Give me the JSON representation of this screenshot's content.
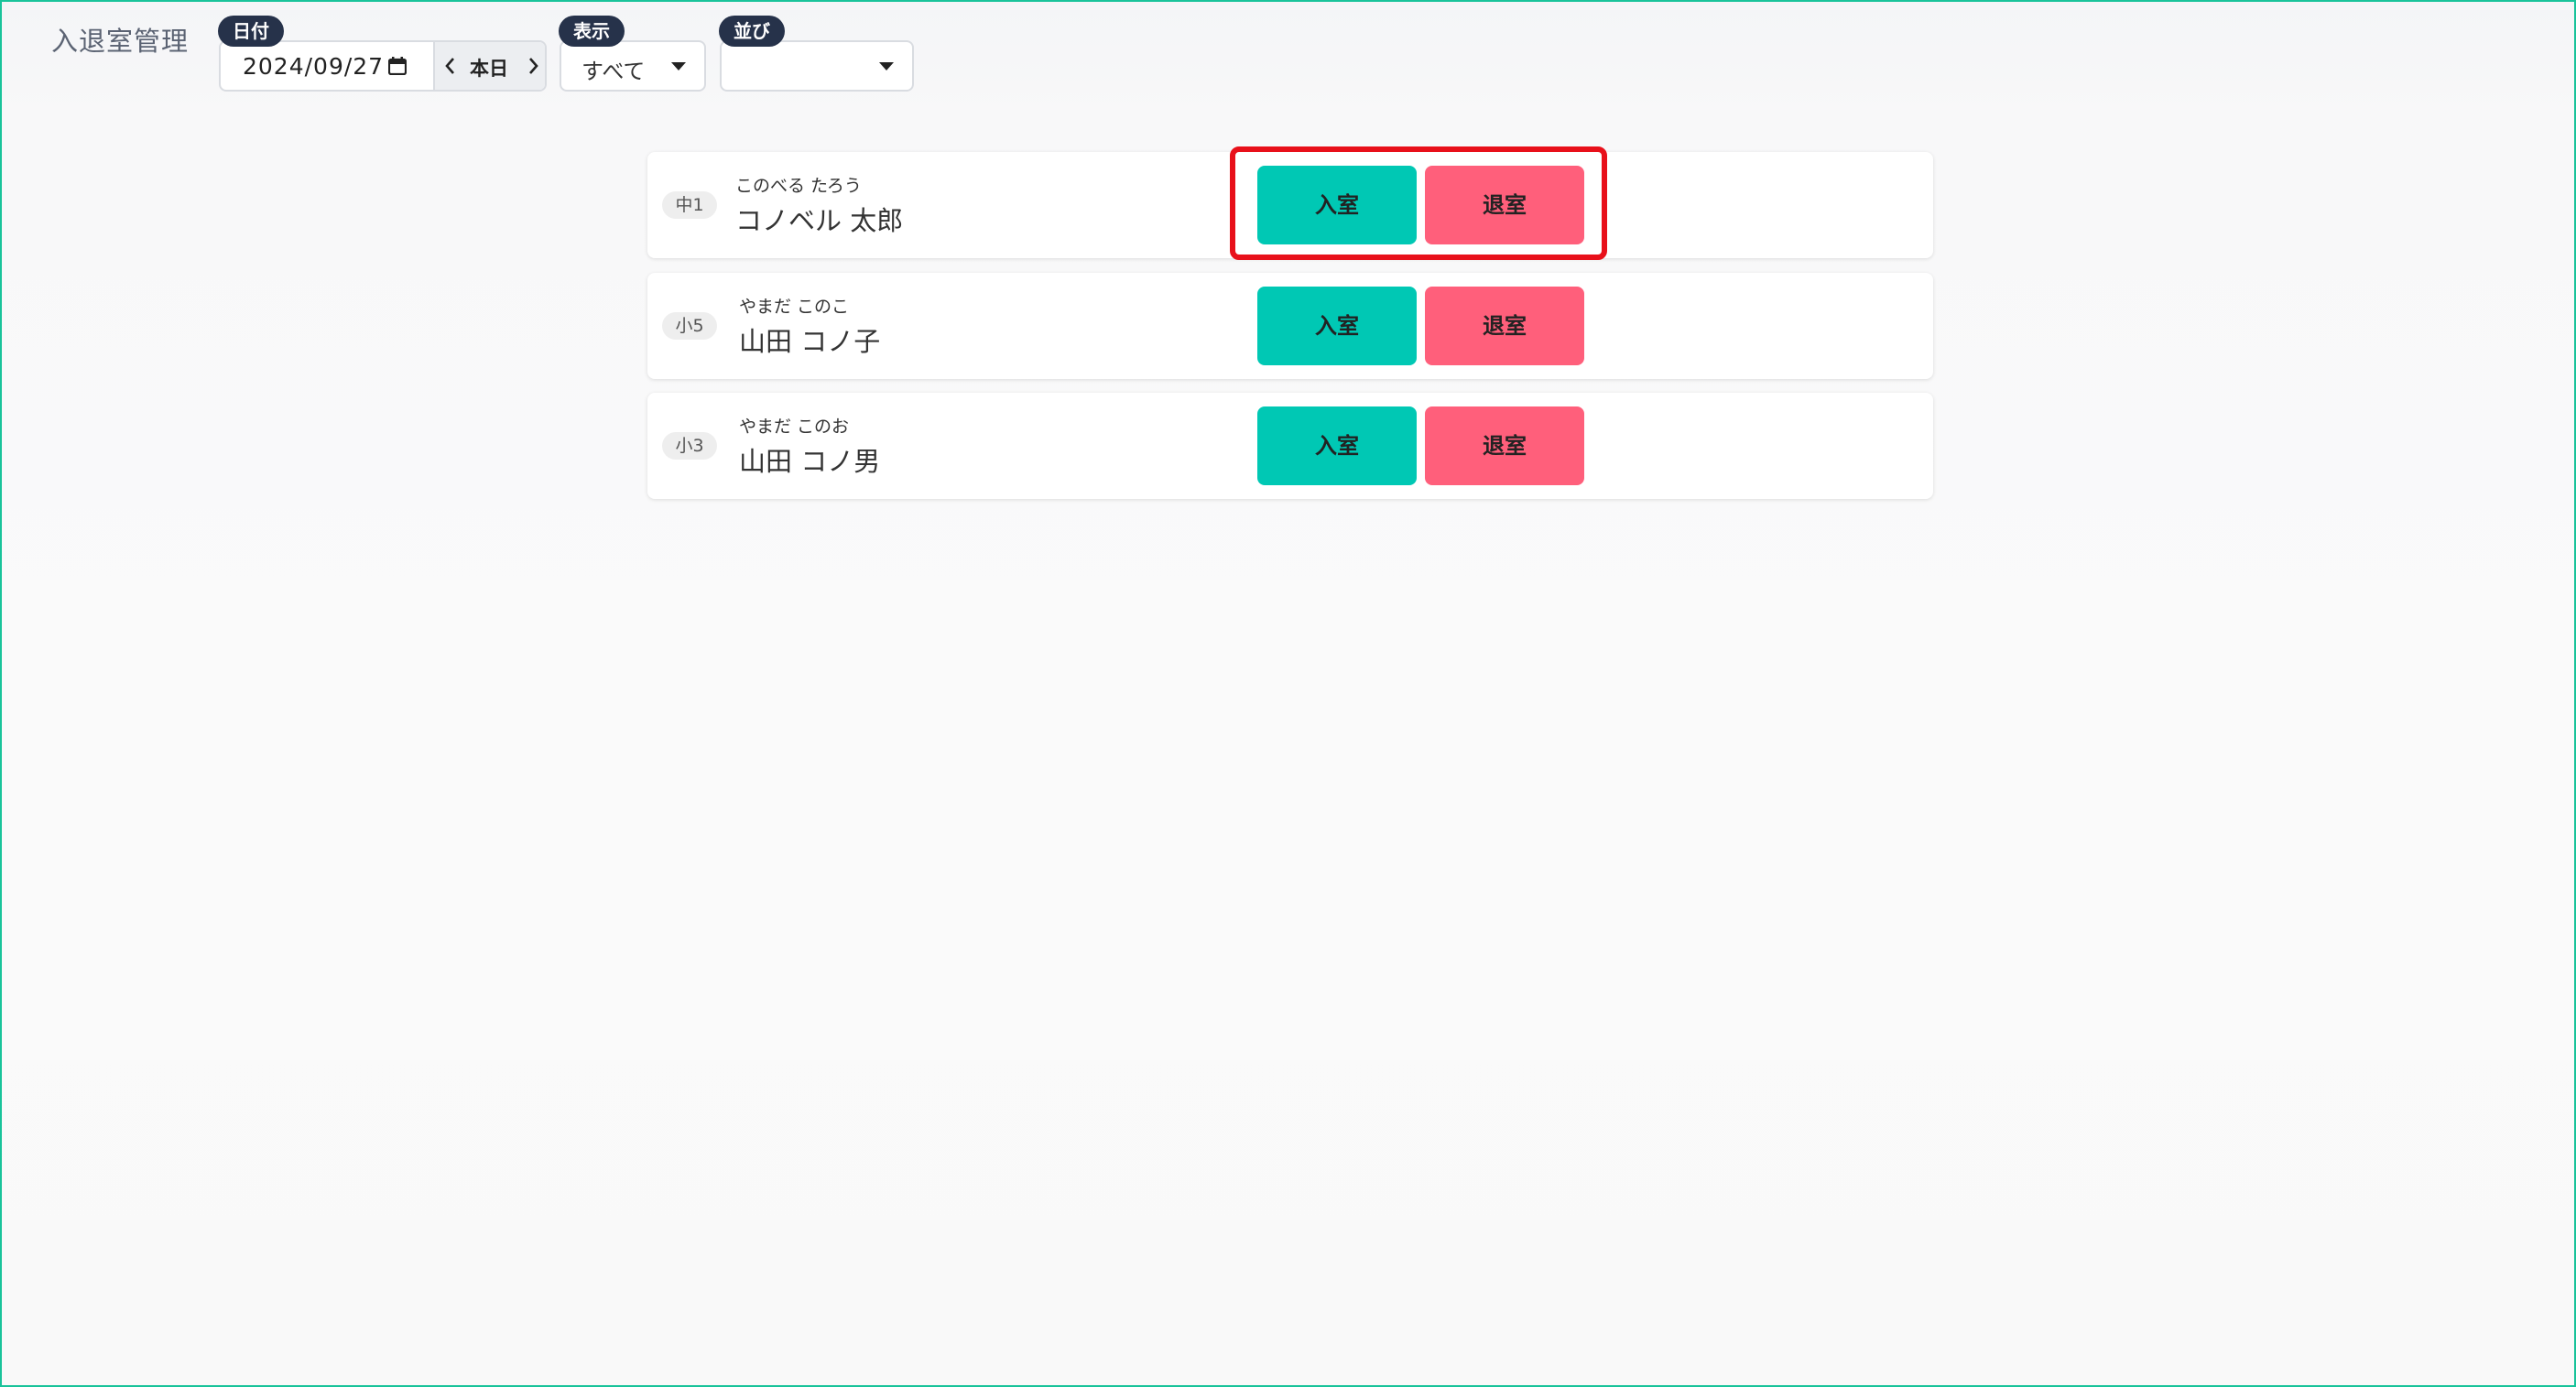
{
  "header": {
    "title": "入退室管理"
  },
  "filters": {
    "date": {
      "label": "日付",
      "value": "2024/09/27",
      "today_label": "本日"
    },
    "show": {
      "label": "表示",
      "value": "すべて"
    },
    "sort": {
      "label": "並び",
      "value": ""
    }
  },
  "students": [
    {
      "grade": "中1",
      "kana": "このべる たろう",
      "name": "コノベル 太郎",
      "enter_label": "入室",
      "exit_label": "退室"
    },
    {
      "grade": "小5",
      "kana": "やまだ このこ",
      "name": "山田 コノ子",
      "enter_label": "入室",
      "exit_label": "退室"
    },
    {
      "grade": "小3",
      "kana": "やまだ このお",
      "name": "山田 コノ男",
      "enter_label": "入室",
      "exit_label": "退室"
    }
  ],
  "colors": {
    "enter_button": "#00c8b4",
    "exit_button": "#ff5f7b",
    "label_pill": "#26324a",
    "highlight": "#e8101a",
    "frame_border": "#19c39a"
  },
  "icons": {
    "date_picker": "calendar-icon",
    "previous_day": "chevron-left-icon",
    "next_day": "chevron-right-icon",
    "dropdown": "caret-down-icon"
  }
}
